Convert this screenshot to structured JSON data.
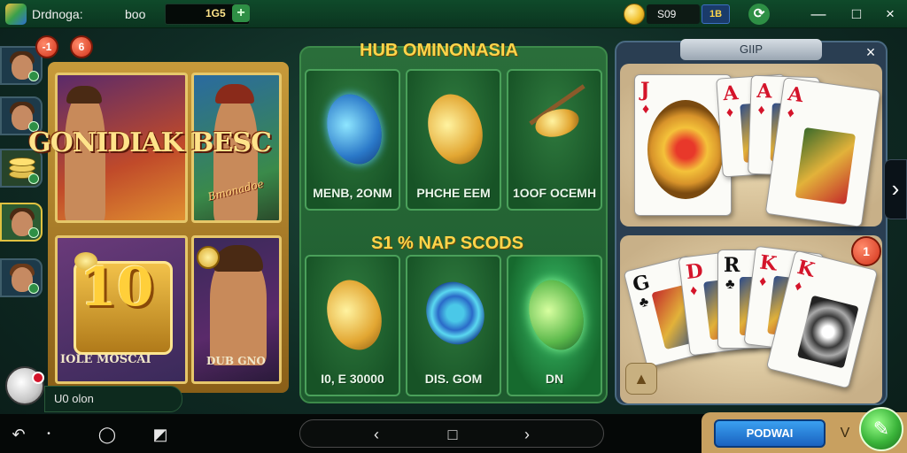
{
  "header": {
    "app_title": "Drdnoga:",
    "balance_label": "boo",
    "balance_value": "1G5",
    "balance_plus": "+",
    "coins_value": "S09",
    "coins_badge": "1B",
    "window_controls": {
      "minimize": "—",
      "maximize": "□",
      "close": "×"
    }
  },
  "sidebar": {
    "notifications": [
      "-1",
      "6"
    ],
    "avatars": [
      "player-1",
      "player-2",
      "coins",
      "player-4",
      "player-5"
    ]
  },
  "featured": {
    "logo_text": "GONIDIAK BESC",
    "logo_script": "Bmonadoe",
    "big_number": "10",
    "tile3_caption": "IOLE MOSCAI",
    "tile4_caption": "DUB GNO"
  },
  "middle": {
    "section1_title": "HUB OMINONASIA",
    "section2_title": "S1 % NAP SCODS",
    "cards_top": [
      "MENB, 2ONM",
      "PHCHE EEM",
      "1OOF OCEMH"
    ],
    "cards_bottom": [
      "I0, E 30000",
      "DIS. GOM",
      "DN"
    ]
  },
  "right_panel": {
    "tab_label": "GIIP",
    "close": "×",
    "badge": "1",
    "home_icon": "▲",
    "side_arrow": "›",
    "top_cards": [
      {
        "rank": "J",
        "suit": "♦",
        "color": "red"
      },
      {
        "rank": "A",
        "suit": "♦",
        "color": "red"
      },
      {
        "rank": "A",
        "suit": "♦",
        "color": "red"
      },
      {
        "rank": "A",
        "suit": "♦",
        "color": "red"
      }
    ],
    "hand_cards": [
      {
        "rank": "G",
        "suit": "♣",
        "color": "black"
      },
      {
        "rank": "D",
        "suit": "♦",
        "color": "red"
      },
      {
        "rank": "R",
        "suit": "♣",
        "color": "black"
      },
      {
        "rank": "K",
        "suit": "♦",
        "color": "red"
      },
      {
        "rank": "K",
        "suit": "♦",
        "color": "red"
      }
    ]
  },
  "bottom": {
    "status_text": "U0 olon",
    "play_button": "PODWAI",
    "chevron": "V",
    "go_icon": "✎"
  },
  "nav": {
    "back": "↶",
    "dot": "•",
    "chat": "◯",
    "screenshot": "◩",
    "left": "‹",
    "home": "□",
    "right": "›"
  }
}
